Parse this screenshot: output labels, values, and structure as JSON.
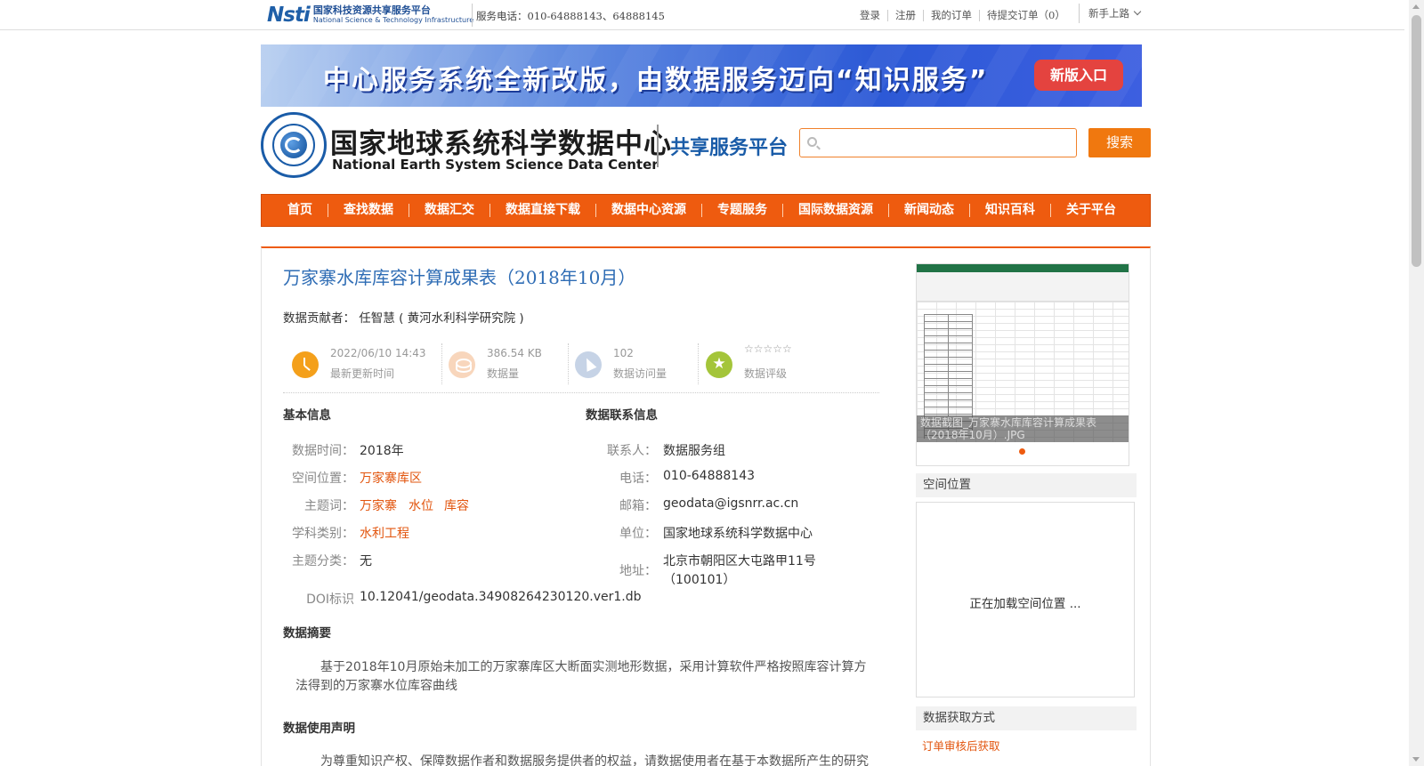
{
  "topbar": {
    "logo_mark": "Nsti",
    "logo_cn": "国家科技资源共享服务平台",
    "logo_en": "National Science & Technology Infrastructure",
    "phone": "服务电话：010-64888143、64888145",
    "links": [
      "登录",
      "注册",
      "我的订单",
      "待提交订单（0）"
    ],
    "guide": "新手上路"
  },
  "banner": {
    "text": "中心服务系统全新改版，由数据服务迈向“知识服务”",
    "button": "新版入口"
  },
  "header": {
    "name_cn": "国家地球系统科学数据中心",
    "name_en": "National Earth System Science Data Center",
    "platform": "共享服务平台",
    "search_placeholder": "",
    "search_button": "搜索"
  },
  "nav": [
    "首页",
    "查找数据",
    "数据汇交",
    "数据直接下载",
    "数据中心资源",
    "专题服务",
    "国际数据资源",
    "新闻动态",
    "知识百科",
    "关于平台"
  ],
  "dataset": {
    "title": "万家寨水库库容计算成果表（2018年10月）",
    "contributor": "数据贡献者： 任智慧 ( 黄河水利科学研究院 )",
    "stats": {
      "updated": "2022/06/10 14:43",
      "updated_label": "最新更新时间",
      "size": "386.54 KB",
      "size_label": "数据量",
      "visits": "102",
      "visits_label": "数据访问量",
      "rating_stars": "☆☆☆☆☆",
      "rating_label": "数据评级"
    }
  },
  "basic_info": {
    "heading": "基本信息",
    "time_key": "数据时间：",
    "time_val": "2018年",
    "space_key": "空间位置：",
    "space_val": "万家寨库区",
    "keywords_key": "主题词：",
    "keywords": [
      "万家寨",
      "水位",
      "库容"
    ],
    "subject_key": "学科类别：",
    "subject_val": "水利工程",
    "category_key": "主题分类：",
    "category_val": "无",
    "doi_key": "DOI标识",
    "doi_val": "10.12041/geodata.34908264230120.ver1.db"
  },
  "contact_info": {
    "heading": "数据联系信息",
    "contact_key": "联系人：",
    "contact_val": "数据服务组",
    "phone_key": "电话：",
    "phone_val": "010-64888143",
    "email_key": "邮箱：",
    "email_val": "geodata@igsnrr.ac.cn",
    "unit_key": "单位：",
    "unit_val": "国家地球系统科学数据中心",
    "address_key": "地址：",
    "address_line1": "北京市朝阳区大屯路甲11号",
    "address_line2": "（100101）"
  },
  "abstract": {
    "heading": "数据摘要",
    "text": "基于2018年10月原始未加工的万家寨库区大断面实测地形数据，采用计算软件严格按照库容计算方法得到的万家寨水位库容曲线"
  },
  "usage": {
    "heading": "数据使用声明",
    "text": "为尊重知识产权、保障数据作者和数据服务提供者的权益，请数据使用者在基于本数据所产生的研究"
  },
  "sidebar": {
    "thumb_caption": "数据截图_万家寨水库库容计算成果表（2018年10月）.JPG",
    "spatial_heading": "空间位置",
    "map_loading": "正在加载空间位置 ...",
    "access_heading": "数据获取方式",
    "access_link": "订单审核后获取"
  },
  "colors": {
    "accent": "#ee5b0f",
    "title_blue": "#2f6db5",
    "link_orange": "#e2550e"
  }
}
